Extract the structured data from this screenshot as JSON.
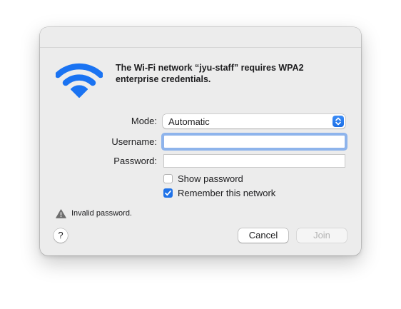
{
  "dialog": {
    "message": "The Wi-Fi network “jyu-staff” requires WPA2 enterprise credentials.",
    "icon": "wifi-icon",
    "accent_color": "#1f72e8"
  },
  "form": {
    "mode_label": "Mode:",
    "mode_value": "Automatic",
    "username_label": "Username:",
    "username_value": "",
    "password_label": "Password:",
    "password_value": "",
    "show_password_label": "Show password",
    "show_password_checked": false,
    "remember_label": "Remember this network",
    "remember_checked": true
  },
  "status": {
    "icon": "warning-icon",
    "text": "Invalid password."
  },
  "buttons": {
    "help": "?",
    "cancel": "Cancel",
    "join": "Join"
  }
}
